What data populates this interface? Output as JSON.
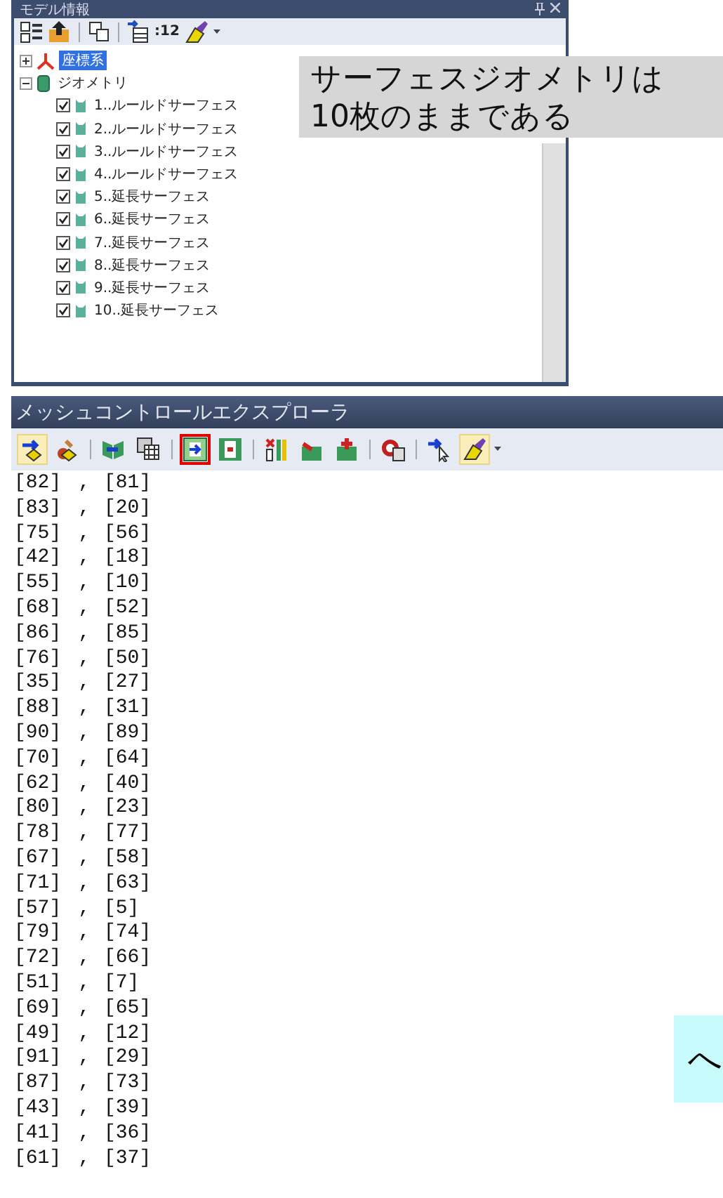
{
  "model_panel": {
    "title": "モデル情報",
    "toolbar": [
      {
        "kind": "button"
      },
      {
        "kind": "button"
      },
      {
        "kind": "separator"
      },
      {
        "kind": "button"
      },
      {
        "kind": "separator"
      },
      {
        "kind": "button"
      },
      {
        "kind": "text",
        "label": ":12"
      },
      {
        "kind": "dropdown"
      }
    ],
    "tree": [
      {
        "label": "座標系",
        "kind": "axes",
        "expanded": false,
        "selected": true
      },
      {
        "label": "ジオメトリ",
        "kind": "geometry",
        "expanded": true,
        "selected": false,
        "children": [
          {
            "label": "1..ルールドサーフェス",
            "checked": true
          },
          {
            "label": "2..ルールドサーフェス",
            "checked": true
          },
          {
            "label": "3..ルールドサーフェス",
            "checked": true
          },
          {
            "label": "4..ルールドサーフェス",
            "checked": true
          },
          {
            "label": "5..延長サーフェス",
            "checked": true
          },
          {
            "label": "6..延長サーフェス",
            "checked": true
          },
          {
            "label": "7..延長サーフェス",
            "checked": true
          },
          {
            "label": "8..延長サーフェス",
            "checked": true
          },
          {
            "label": "9..延長サーフェス",
            "checked": true
          },
          {
            "label": "10..延長サーフェス",
            "checked": true
          }
        ]
      }
    ]
  },
  "callout": {
    "lines": [
      "サーフェスジオメトリは",
      "10枚のままである"
    ]
  },
  "mesh_panel": {
    "title": "メッシュコントロールエクスプローラ",
    "toolbar": [
      {
        "kind": "button",
        "pressed": true,
        "highlighted": false
      },
      {
        "kind": "button",
        "pressed": false,
        "highlighted": false
      },
      {
        "kind": "separator"
      },
      {
        "kind": "button",
        "pressed": false,
        "highlighted": false
      },
      {
        "kind": "button",
        "pressed": false,
        "highlighted": false
      },
      {
        "kind": "separator"
      },
      {
        "kind": "button",
        "pressed": false,
        "highlighted": true
      },
      {
        "kind": "button",
        "pressed": false,
        "highlighted": false
      },
      {
        "kind": "separator"
      },
      {
        "kind": "button",
        "pressed": false,
        "highlighted": false
      },
      {
        "kind": "button",
        "pressed": false,
        "highlighted": false
      },
      {
        "kind": "button",
        "pressed": false,
        "highlighted": false
      },
      {
        "kind": "separator"
      },
      {
        "kind": "button",
        "pressed": false,
        "highlighted": false
      },
      {
        "kind": "separator"
      },
      {
        "kind": "button",
        "pressed": false,
        "highlighted": false
      },
      {
        "kind": "button",
        "pressed": true,
        "highlighted": false
      },
      {
        "kind": "dropdown"
      }
    ],
    "rows": [
      {
        "left": "[82]",
        "sep": ",",
        "right": "[81]"
      },
      {
        "left": "[83]",
        "sep": ",",
        "right": "[20]"
      },
      {
        "left": "[75]",
        "sep": ",",
        "right": "[56]"
      },
      {
        "left": "[42]",
        "sep": ",",
        "right": "[18]"
      },
      {
        "left": "[55]",
        "sep": ",",
        "right": "[10]"
      },
      {
        "left": "[68]",
        "sep": ",",
        "right": "[52]"
      },
      {
        "left": "[86]",
        "sep": ",",
        "right": "[85]"
      },
      {
        "left": "[76]",
        "sep": ",",
        "right": "[50]"
      },
      {
        "left": "[35]",
        "sep": ",",
        "right": "[27]"
      },
      {
        "left": "[88]",
        "sep": ",",
        "right": "[31]"
      },
      {
        "left": "[90]",
        "sep": ",",
        "right": "[89]"
      },
      {
        "left": "[70]",
        "sep": ",",
        "right": "[64]"
      },
      {
        "left": "[62]",
        "sep": ",",
        "right": "[40]"
      },
      {
        "left": "[80]",
        "sep": ",",
        "right": "[23]"
      },
      {
        "left": "[78]",
        "sep": ",",
        "right": "[77]"
      },
      {
        "left": "[67]",
        "sep": ",",
        "right": "[58]"
      },
      {
        "left": "[71]",
        "sep": ",",
        "right": "[63]"
      },
      {
        "left": "[57]",
        "sep": ",",
        "right": "[5]"
      },
      {
        "left": "[79]",
        "sep": ",",
        "right": "[74]"
      },
      {
        "left": "[72]",
        "sep": ",",
        "right": "[66]"
      },
      {
        "left": "[51]",
        "sep": ",",
        "right": "[7]"
      },
      {
        "left": "[69]",
        "sep": ",",
        "right": "[65]"
      },
      {
        "left": "[49]",
        "sep": ",",
        "right": "[12]"
      },
      {
        "left": "[91]",
        "sep": ",",
        "right": "[29]"
      },
      {
        "left": "[87]",
        "sep": ",",
        "right": "[73]"
      },
      {
        "left": "[43]",
        "sep": ",",
        "right": "[39]"
      },
      {
        "left": "[41]",
        "sep": ",",
        "right": "[36]"
      },
      {
        "left": "[61]",
        "sep": ",",
        "right": "[37]"
      }
    ]
  },
  "note": {
    "text": "へ"
  }
}
